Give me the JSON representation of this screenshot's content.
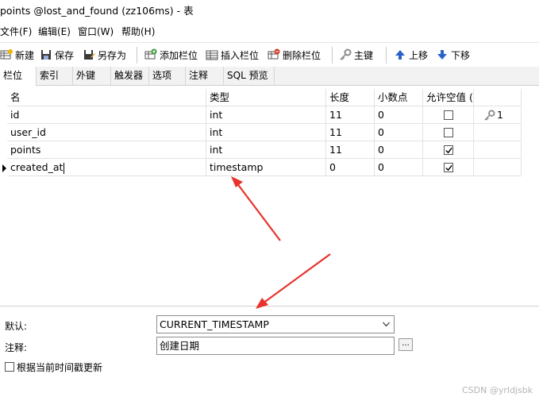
{
  "window": {
    "title": "points @lost_and_found (zz106ms) - 表"
  },
  "menu": [
    "文件(F)",
    "编辑(E)",
    "窗口(W)",
    "帮助(H)"
  ],
  "toolbar": {
    "new": "新建",
    "save": "保存",
    "save_as": "另存为",
    "add_field": "添加栏位",
    "insert_field": "插入栏位",
    "delete_field": "删除栏位",
    "primary_key": "主键",
    "move_up": "上移",
    "move_down": "下移"
  },
  "tabs": [
    "栏位",
    "索引",
    "外键",
    "触发器",
    "选项",
    "注释",
    "SQL 预览"
  ],
  "table": {
    "headers": {
      "name": "名",
      "type": "类型",
      "length": "长度",
      "decimals": "小数点",
      "nullable": "允许空值 ("
    },
    "rows": [
      {
        "name": "id",
        "type": "int",
        "length": "11",
        "decimals": "0",
        "nullable": false,
        "key": "1"
      },
      {
        "name": "user_id",
        "type": "int",
        "length": "11",
        "decimals": "0",
        "nullable": false,
        "key": ""
      },
      {
        "name": "points",
        "type": "int",
        "length": "11",
        "decimals": "0",
        "nullable": true,
        "key": ""
      },
      {
        "name": "created_at",
        "type": "timestamp",
        "length": "0",
        "decimals": "0",
        "nullable": true,
        "key": ""
      }
    ]
  },
  "properties": {
    "default_label": "默认:",
    "default_value": "CURRENT_TIMESTAMP",
    "comment_label": "注释:",
    "comment_value": "创建日期",
    "dots_label": "...",
    "on_update_label": "根据当前时间戳更新"
  },
  "watermark": "CSDN @yrldjsbk",
  "colors": {
    "annotation_arrow": "#e8322b",
    "move_arrow": "#2a62c9",
    "key_icon": "#8a8a8a"
  }
}
